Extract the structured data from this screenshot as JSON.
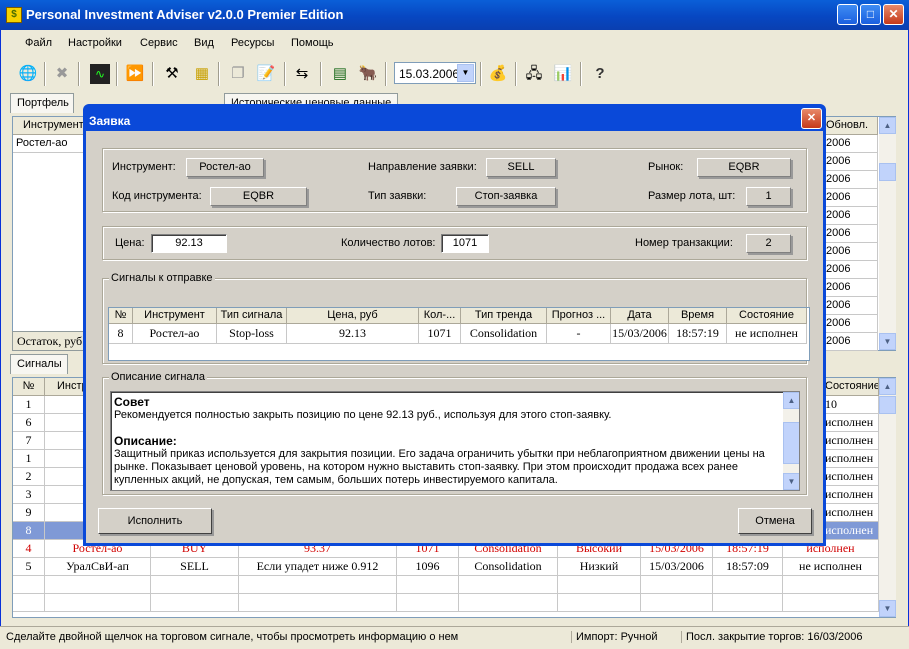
{
  "app": {
    "title": "Personal Investment Adviser v2.0.0 Premier Edition"
  },
  "menu": [
    "Файл",
    "Настройки",
    "Сервис",
    "Вид",
    "Ресурсы",
    "Помощь"
  ],
  "toolbar": {
    "date": "15.03.2006"
  },
  "tabs": {
    "portfolio": "Портфель",
    "history": "Исторические ценовые данные",
    "signals": "Сигналы"
  },
  "portfolio": {
    "header_instrument": "Инструмент",
    "header_updated": "Обновл.",
    "first_row": "Ростел-ао",
    "dates": [
      "2006",
      "2006",
      "2006",
      "2006",
      "2006",
      "2006",
      "2006",
      "2006",
      "2006",
      "2006",
      "2006",
      "2006"
    ],
    "footer": "Остаток, руб"
  },
  "signals_grid": {
    "header_no": "№",
    "header_instr": "Инстр",
    "header_state": "Состояние",
    "rows_partial": [
      {
        "no": "1",
        "instr": "",
        "state": "10"
      },
      {
        "no": "6",
        "instr": "С",
        "state": "исполнен"
      },
      {
        "no": "7",
        "instr": "",
        "state": "исполнен"
      },
      {
        "no": "1",
        "instr": "Ав",
        "state": "исполнен"
      },
      {
        "no": "2",
        "instr": "РА",
        "state": "исполнен"
      },
      {
        "no": "3",
        "instr": "РА",
        "state": "исполнен"
      },
      {
        "no": "9",
        "instr": "Ро",
        "state": "исполнен"
      },
      {
        "no": "8",
        "instr": "Ро",
        "state": "исполнен"
      }
    ],
    "rows_full": [
      {
        "no": "4",
        "instr": "Ростел-ао",
        "type": "BUY",
        "price": "93.37",
        "qty": "1071",
        "trend": "Consolidation",
        "forecast": "Высокий",
        "date": "15/03/2006",
        "time": "18:57:19",
        "state": "исполнен",
        "red": true
      },
      {
        "no": "5",
        "instr": "УралСвИ-ап",
        "type": "SELL",
        "price": "Если упадет ниже 0.912",
        "qty": "1096",
        "trend": "Consolidation",
        "forecast": "Низкий",
        "date": "15/03/2006",
        "time": "18:57:09",
        "state": "не исполнен",
        "red": false
      }
    ]
  },
  "status": {
    "hint": "Сделайте двойной щелчок на торговом сигнале, чтобы просмотреть информацию о нем",
    "import": "Импорт: Ручной",
    "last_close": "Посл. закрытие торгов:  16/03/2006"
  },
  "dialog": {
    "title": "Заявка",
    "instrument_label": "Инструмент:",
    "instrument": "Ростел-ао",
    "direction_label": "Направление заявки:",
    "direction": "SELL",
    "market_label": "Рынок:",
    "market": "EQBR",
    "code_label": "Код инструмента:",
    "code": "EQBR",
    "order_type_label": "Тип заявки:",
    "order_type": "Стоп-заявка",
    "lot_label": "Размер лота, шт:",
    "lot": "1",
    "price_label": "Цена:",
    "price": "92.13",
    "qty_label": "Количество лотов:",
    "qty": "1071",
    "tx_label": "Номер транзакции:",
    "tx": "2",
    "signals_legend": "Сигналы к отправке",
    "grid_headers": [
      "№",
      "Инструмент",
      "Тип сигнала",
      "Цена, руб",
      "Кол-...",
      "Тип тренда",
      "Прогноз ...",
      "Дата",
      "Время",
      "Состояние"
    ],
    "grid_row": [
      "8",
      "Ростел-ао",
      "Stop-loss",
      "92.13",
      "1071",
      "Consolidation",
      "-",
      "15/03/2006",
      "18:57:19",
      "не исполнен"
    ],
    "desc_legend": "Описание сигнала",
    "advice_title": "Совет",
    "advice_text": "Рекомендуется полностью закрыть позицию по цене 92.13 руб., используя для этого стоп-заявку.",
    "desc_title": "Описание:",
    "desc_text": "Защитный приказ используется для закрытия позиции. Его задача ограничить убытки при неблагоприятном движении цены на рынке. Показывает ценовой уровень, на котором нужно выставить стоп-заявку. При этом происходит продажа всех ранее купленных акций, не допуская, тем самым, больших потерь инвестируемого капитала.",
    "execute": "Исполнить",
    "cancel": "Отмена"
  }
}
